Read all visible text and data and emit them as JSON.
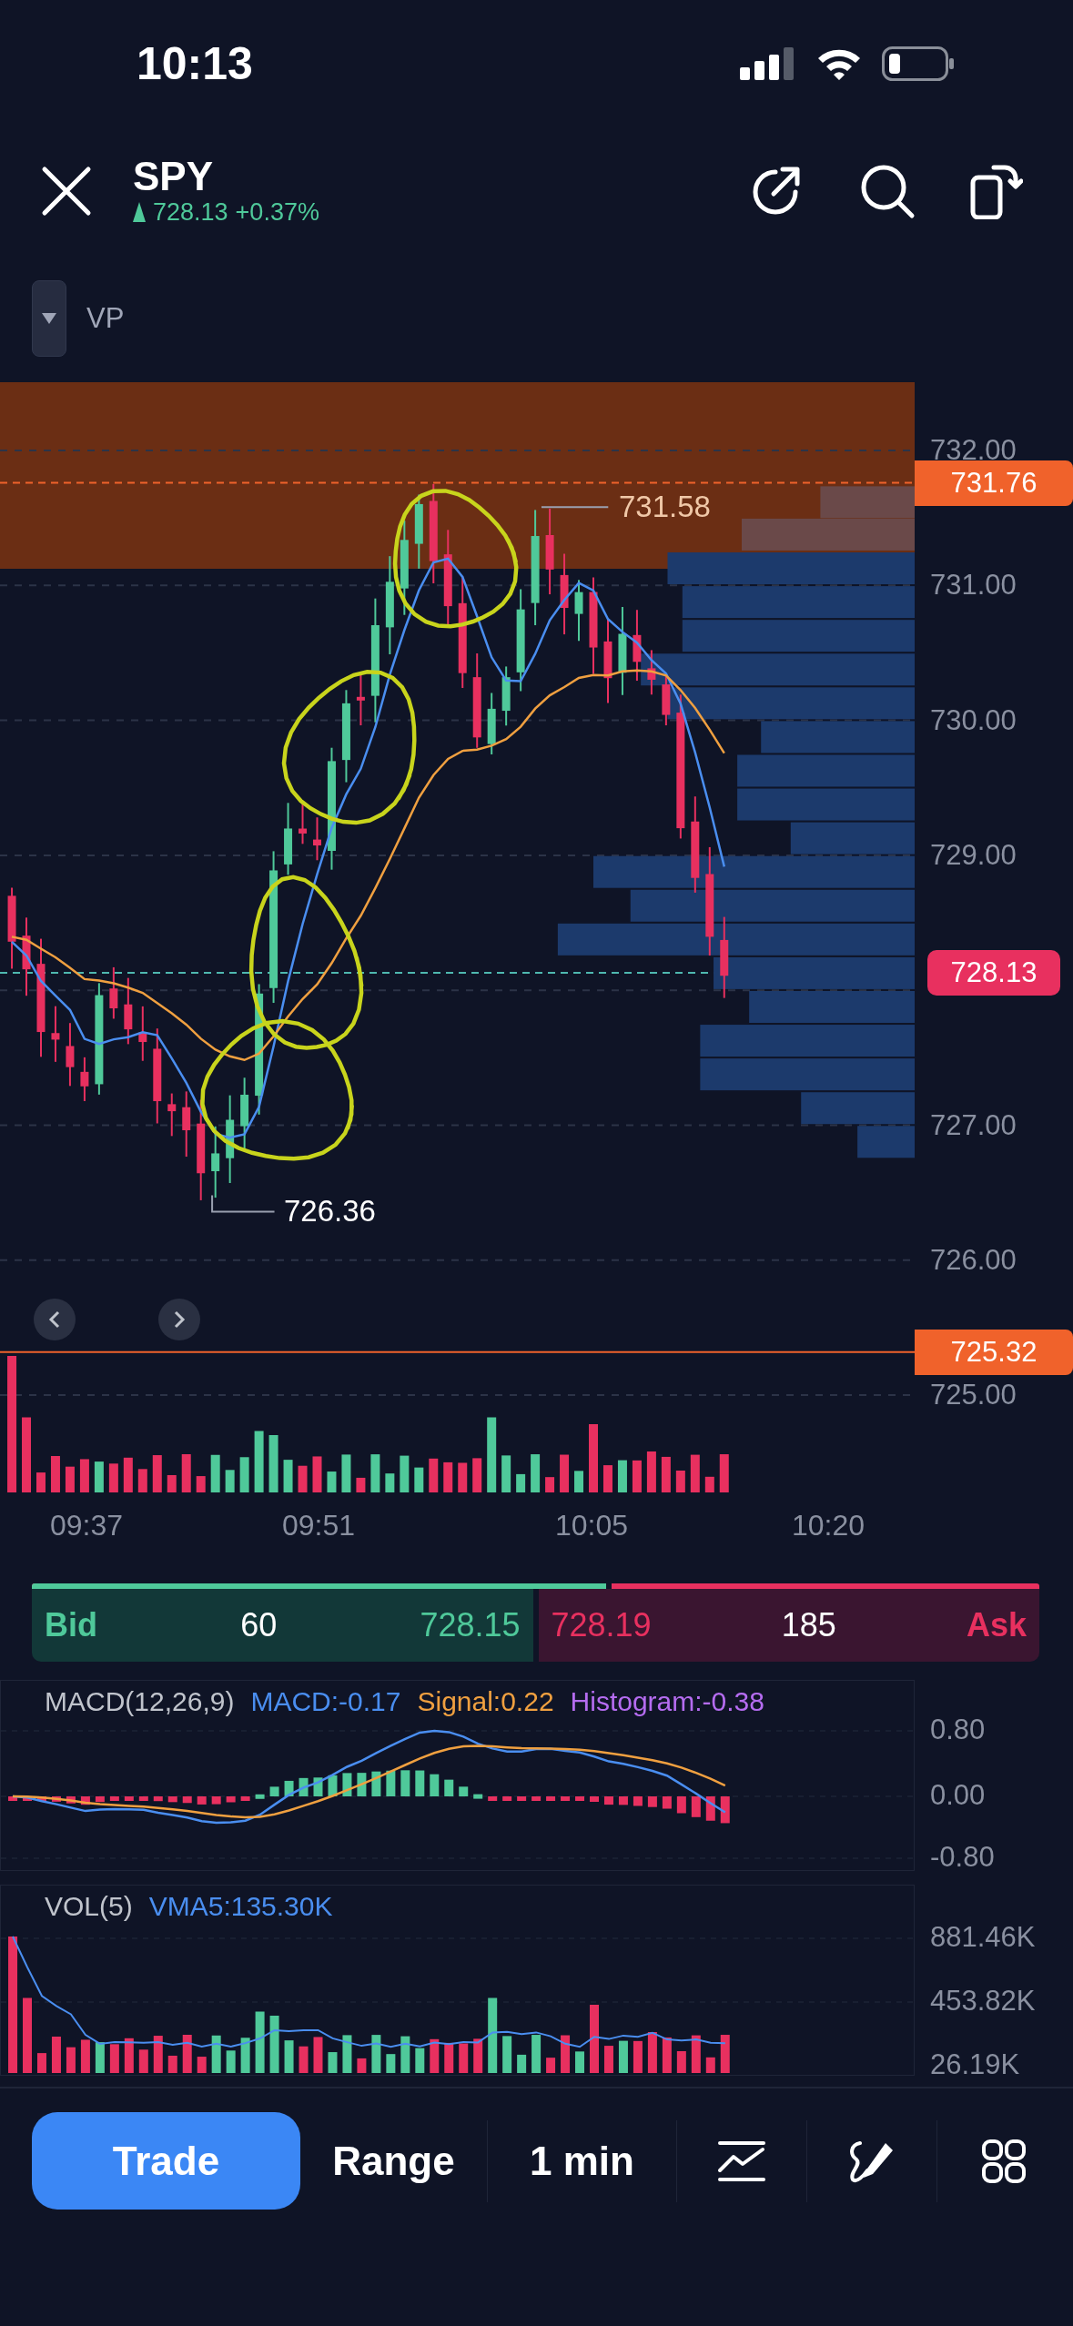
{
  "status_bar": {
    "time": "10:13"
  },
  "header": {
    "symbol": "SPY",
    "price": "728.13",
    "change": "+0.37%"
  },
  "indicator_toggle": {
    "label": "VP",
    "expanded": false
  },
  "price_chart": {
    "price_axis": [
      "732.00",
      "731.00",
      "730.00",
      "729.00",
      "727.00",
      "726.00",
      "725.00"
    ],
    "price_badges": [
      {
        "label": "731.76",
        "color": "#f0622b"
      },
      {
        "label": "728.13",
        "color": "#e8305f"
      },
      {
        "label": "725.32",
        "color": "#f0622b"
      }
    ],
    "high_label": "731.58",
    "low_label": "726.36",
    "time_axis": [
      "09:37",
      "09:51",
      "10:05",
      "10:20"
    ]
  },
  "bid_ask": {
    "level": 0.575,
    "bid": {
      "label": "Bid",
      "size": "60",
      "price": "728.15"
    },
    "ask": {
      "price": "728.19",
      "size": "185",
      "label": "Ask"
    }
  },
  "macd": {
    "title": "MACD(12,26,9)",
    "values": [
      {
        "text": "MACD:-0.17",
        "color": "#4a8ef0"
      },
      {
        "text": "Signal:0.22",
        "color": "#f0a040"
      },
      {
        "text": "Histogram:-0.38",
        "color": "#b56cf0"
      }
    ],
    "axis": [
      "0.80",
      "0.00",
      "-0.80"
    ]
  },
  "volume": {
    "title": "VOL(5)",
    "values": [
      {
        "text": "VMA5:135.30K",
        "color": "#4a8ef0"
      }
    ],
    "axis": [
      "881.46K",
      "453.82K",
      "26.19K"
    ]
  },
  "toolbar": {
    "trade": "Trade",
    "range": "Range",
    "interval": "1 min"
  }
}
